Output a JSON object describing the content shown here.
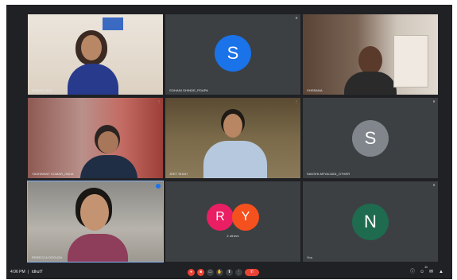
{
  "tiles": [
    {
      "name": "IKRA ALOMA",
      "id": "t1"
    },
    {
      "name": "SOHANI SHINDE_PDAPA",
      "avatar": "S",
      "color": "#1a73e8",
      "id": "t2"
    },
    {
      "name": "SHEBANA",
      "id": "t3"
    },
    {
      "name": "YASHWANT KUMAR_INDIA",
      "id": "t4"
    },
    {
      "name": "JEET SHAH",
      "id": "t5"
    },
    {
      "name": "SAKSHI ARYA/JAIN_OTHER",
      "avatar": "S",
      "color": "#80868b",
      "id": "t6"
    },
    {
      "name": "REBECCA DSOUZA",
      "id": "t7"
    },
    {
      "name": "2 others",
      "avatars": [
        "R",
        "Y"
      ],
      "colors": [
        "#e91e63",
        "#f4511e"
      ],
      "id": "t8"
    },
    {
      "name": "You",
      "avatar": "N",
      "color": "#1e6b4f",
      "id": "t9"
    }
  ],
  "bottom": {
    "time": "4:06 PM",
    "separator": "|",
    "meeting_code": "tdkuf7"
  },
  "icons": {
    "mic": "mic-off-icon",
    "camera": "camera-off-icon",
    "captions": "captions-icon",
    "raise": "hand-icon",
    "present": "present-icon",
    "more": "more-icon",
    "end": "end-call-icon",
    "info": "info-icon",
    "people": "people-icon",
    "chat": "chat-icon",
    "activities": "activities-icon"
  },
  "people_count": "11"
}
